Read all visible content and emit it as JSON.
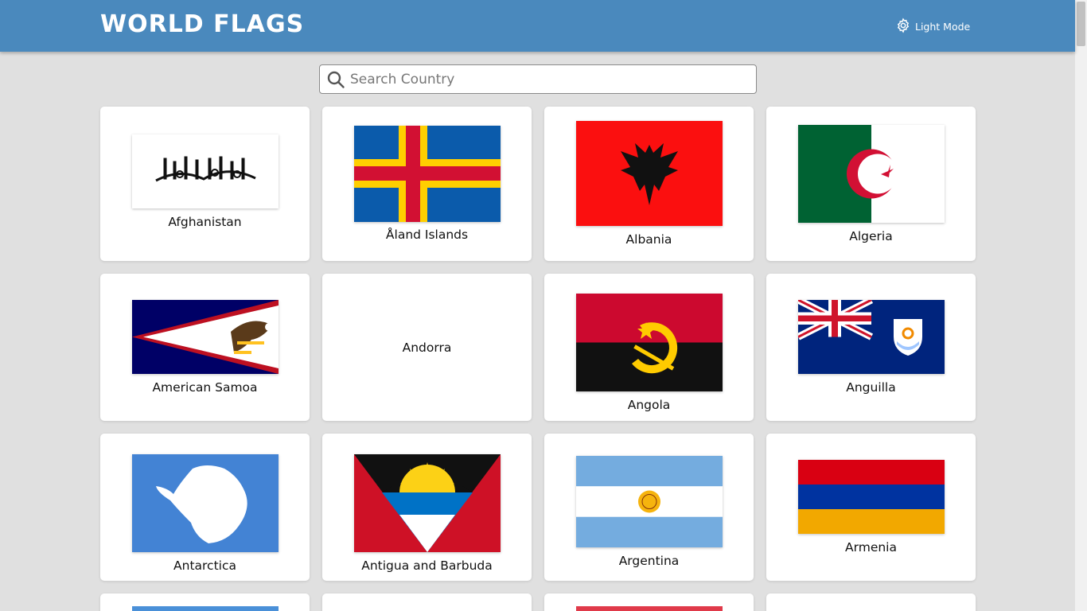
{
  "header": {
    "title": "WORLD FLAGS",
    "mode_label": "Light Mode",
    "mode_icon": "gear-icon",
    "background": "#4a89bd"
  },
  "search": {
    "placeholder": "Search Country",
    "value": "",
    "icon": "search-icon"
  },
  "countries": [
    {
      "name": "Afghanistan"
    },
    {
      "name": "Åland Islands"
    },
    {
      "name": "Albania"
    },
    {
      "name": "Algeria"
    },
    {
      "name": "American Samoa"
    },
    {
      "name": "Andorra"
    },
    {
      "name": "Angola"
    },
    {
      "name": "Anguilla"
    },
    {
      "name": "Antarctica"
    },
    {
      "name": "Antigua and Barbuda"
    },
    {
      "name": "Argentina"
    },
    {
      "name": "Armenia"
    }
  ],
  "colors": {
    "page_background": "#e0e0e0",
    "card_background": "#ffffff"
  }
}
